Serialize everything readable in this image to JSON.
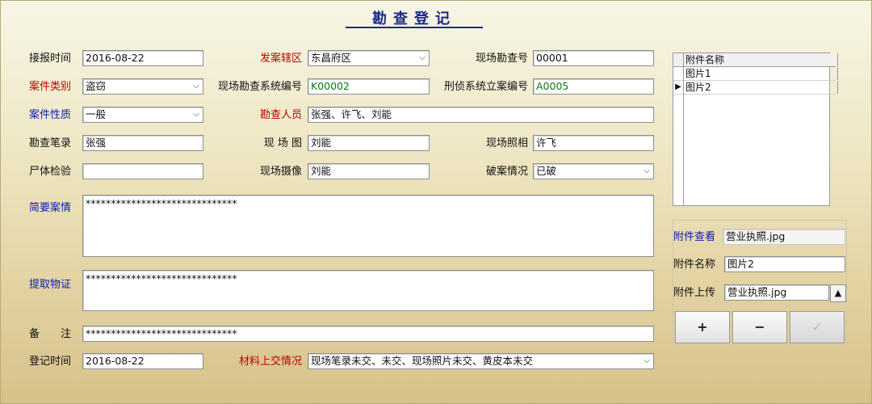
{
  "title": "勘查登记",
  "fields": {
    "report_time": {
      "label": "接报时间",
      "value": "2016-08-22"
    },
    "district": {
      "label": "发案辖区",
      "value": "东昌府区"
    },
    "scene_no": {
      "label": "现场勘查号",
      "value": "00001"
    },
    "case_type": {
      "label": "案件类别",
      "value": "盗窃"
    },
    "scene_sys_no": {
      "label": "现场勘查系统编号",
      "value": "K00002"
    },
    "criminal_no": {
      "label": "刑侦系统立案编号",
      "value": "A0005"
    },
    "case_nature": {
      "label": "案件性质",
      "value": "一般"
    },
    "investigators": {
      "label": "勘查人员",
      "value": "张强、许飞、刘能"
    },
    "record": {
      "label": "勘查笔录",
      "value": "张强"
    },
    "scene_map": {
      "label": "现 场 图",
      "value": "刘能"
    },
    "scene_photo": {
      "label": "现场照相",
      "value": "许飞"
    },
    "autopsy": {
      "label": "尸体检验",
      "value": ""
    },
    "scene_video": {
      "label": "现场摄像",
      "value": "刘能"
    },
    "solved": {
      "label": "破案情况",
      "value": "已破"
    },
    "brief": {
      "label": "简要案情",
      "value": "******************************"
    },
    "evidence": {
      "label": "提取物证",
      "value": "******************************"
    },
    "remark": {
      "label": "备　　注",
      "value": "******************************"
    },
    "reg_time": {
      "label": "登记时间",
      "value": "2016-08-22"
    },
    "materials": {
      "label": "材料上交情况",
      "value": "现场笔录未交、未交、现场照片未交、黄皮本未交"
    }
  },
  "attachments": {
    "header": "附件名称",
    "rows": [
      "图片1",
      "图片2"
    ],
    "current_row_marker": "▶"
  },
  "attachment_panel": {
    "view": {
      "label": "附件查看",
      "value": "营业执照.jpg"
    },
    "name": {
      "label": "附件名称",
      "value": "图片2"
    },
    "upload": {
      "label": "附件上传",
      "value": "营业执照.jpg"
    },
    "upload_button": "▲",
    "add_button": "+",
    "remove_button": "−",
    "confirm_button": "✓"
  },
  "dropdown_glyph": "⌵",
  "colors": {
    "title": "#1a2a8a",
    "red_label": "#c00000",
    "blue_label": "#0a1bb6",
    "green_text": "#0a7a10"
  }
}
